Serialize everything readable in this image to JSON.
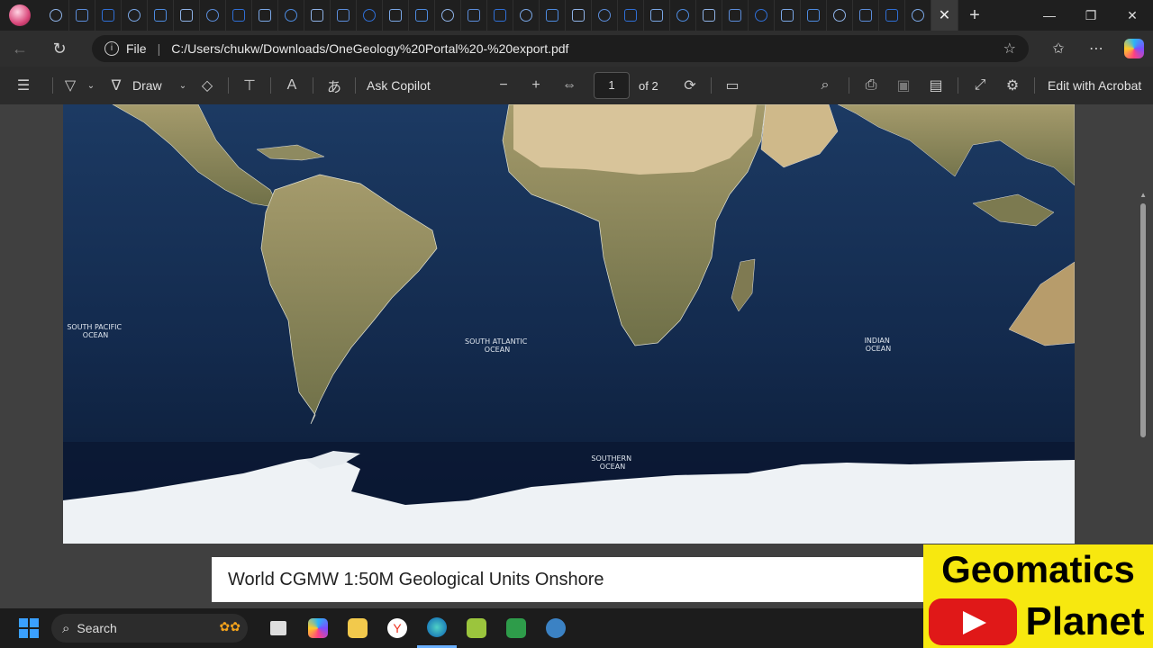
{
  "browser": {
    "tabs_count": 34,
    "active_tab_close": "✕",
    "new_tab": "+",
    "window_controls": {
      "minimize": "—",
      "restore": "❐",
      "close": "✕"
    }
  },
  "address_bar": {
    "scheme_label": "File",
    "url": "C:/Users/chukw/Downloads/OneGeology%20Portal%20-%20export.pdf"
  },
  "pdf_toolbar": {
    "draw_label": "Draw",
    "ask_copilot_label": "Ask Copilot",
    "page_current": "1",
    "page_total_label": "of 2",
    "edit_acrobat_label": "Edit with Acrobat"
  },
  "map": {
    "labels": {
      "south_pacific": "SOUTH PACIFIC\nOCEAN",
      "south_atlantic": "SOUTH ATLANTIC\nOCEAN",
      "indian": "INDIAN\nOCEAN",
      "southern": "SOUTHERN\nOCEAN"
    },
    "colors": {
      "ocean": "#12284a",
      "deep": "#0c1b36",
      "land": "#8a8a5c",
      "desert": "#d8c49a",
      "ice": "#eef2f5"
    }
  },
  "caption": {
    "title": "World CGMW 1:50M Geological Units Onshore"
  },
  "taskbar": {
    "search_label": "Search"
  },
  "watermark": {
    "line1": "Geomatics",
    "line2": "Planet"
  }
}
